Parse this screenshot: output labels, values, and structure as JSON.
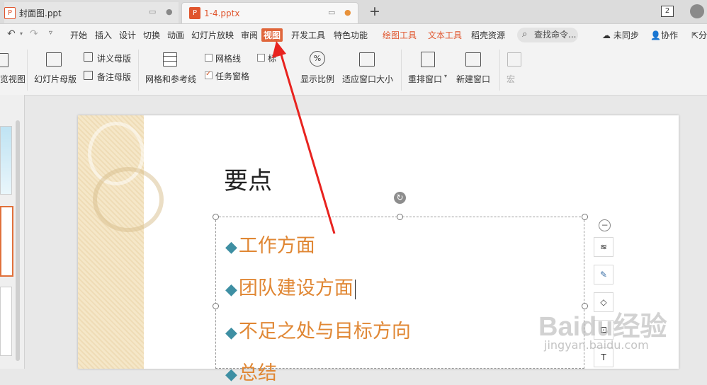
{
  "tabs": [
    {
      "label": "封面图.ppt",
      "active": false
    },
    {
      "label": "1-4.pptx",
      "active": true
    }
  ],
  "tabbar": {
    "new_tab": "+",
    "page_count": "2"
  },
  "menu": {
    "items": [
      "开始",
      "插入",
      "设计",
      "切换",
      "动画",
      "幻灯片放映",
      "审阅",
      "视图",
      "开发工具",
      "特色功能",
      "绘图工具",
      "文本工具",
      "稻壳资源"
    ],
    "search_placeholder": "查找命令...",
    "sync": "未同步",
    "collab": "协作",
    "share": "分"
  },
  "ribbon": {
    "slide_view_partial": "览视图",
    "slide_master": "幻灯片母版",
    "handout_master": "讲义母版",
    "notes_master": "备注母版",
    "grid_and_guides": "网格和参考线",
    "gridlines": "网格线",
    "ruler_partial": "标",
    "task_pane": "任务窗格",
    "zoom": "显示比例",
    "fit_window": "适应窗口大小",
    "arrange_windows": "重排窗口",
    "new_window": "新建窗口",
    "macro": "宏"
  },
  "slide": {
    "title": "要点",
    "bullets": [
      "工作方面",
      "团队建设方面",
      "不足之处与目标方向",
      "总结"
    ],
    "bullet_symbol": "◆"
  },
  "watermark": {
    "text": "Baidu经验",
    "url": "jingyan.baidu.com"
  },
  "colors": {
    "accent": "#e0552d",
    "bullet_text": "#e08734",
    "bullet_mark": "#3e8fa3",
    "annotation": "#e8231f"
  }
}
